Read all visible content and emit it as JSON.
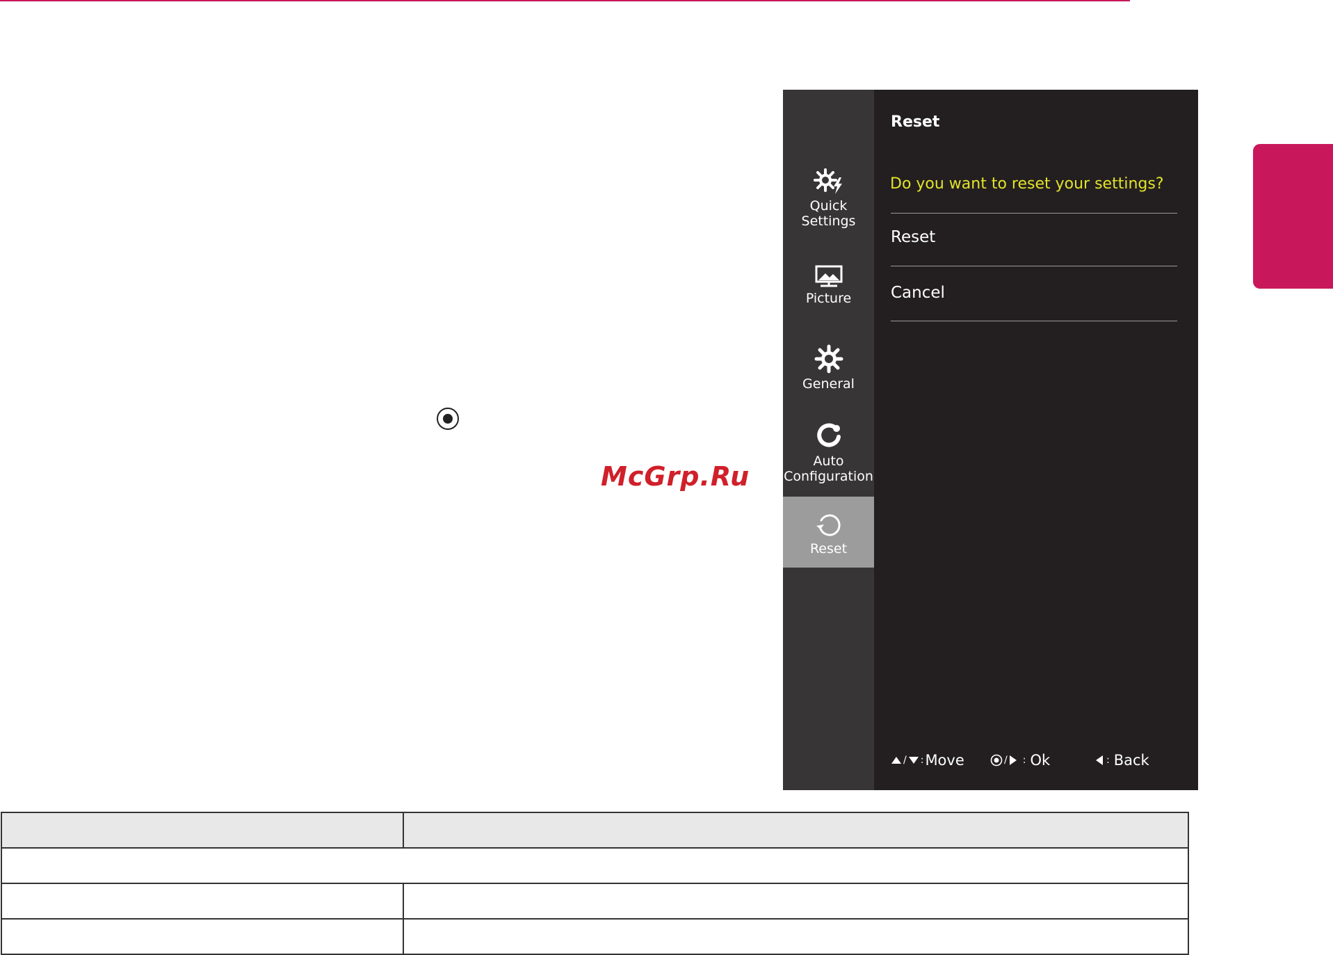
{
  "sidebar": {
    "items": [
      {
        "label_line1": "Quick",
        "label_line2": "Settings",
        "icon": "quick-settings-icon"
      },
      {
        "label_line1": "Picture",
        "icon": "picture-icon"
      },
      {
        "label_line1": "General",
        "icon": "gear-icon"
      },
      {
        "label_line1": "Auto",
        "label_line2": "Configuration",
        "icon": "auto-config-icon"
      },
      {
        "label_line1": "Reset",
        "icon": "reset-icon",
        "active": true
      }
    ]
  },
  "panel": {
    "title": "Reset",
    "prompt": "Do you want to reset your settings?",
    "options": [
      "Reset",
      "Cancel"
    ]
  },
  "footer": {
    "move_sep": "/",
    "move_colon": ":",
    "move": "Move",
    "ok_sep": "/",
    "ok_colon": ":",
    "ok": "Ok",
    "back_colon": ":",
    "back": "Back"
  },
  "watermark": "McGrp.Ru",
  "colors": {
    "accent": "#c8185b",
    "prompt": "#e3e32a",
    "sidebar_bg": "#383536",
    "panel_bg": "#231f20",
    "active_item": "#9c9c9c"
  }
}
